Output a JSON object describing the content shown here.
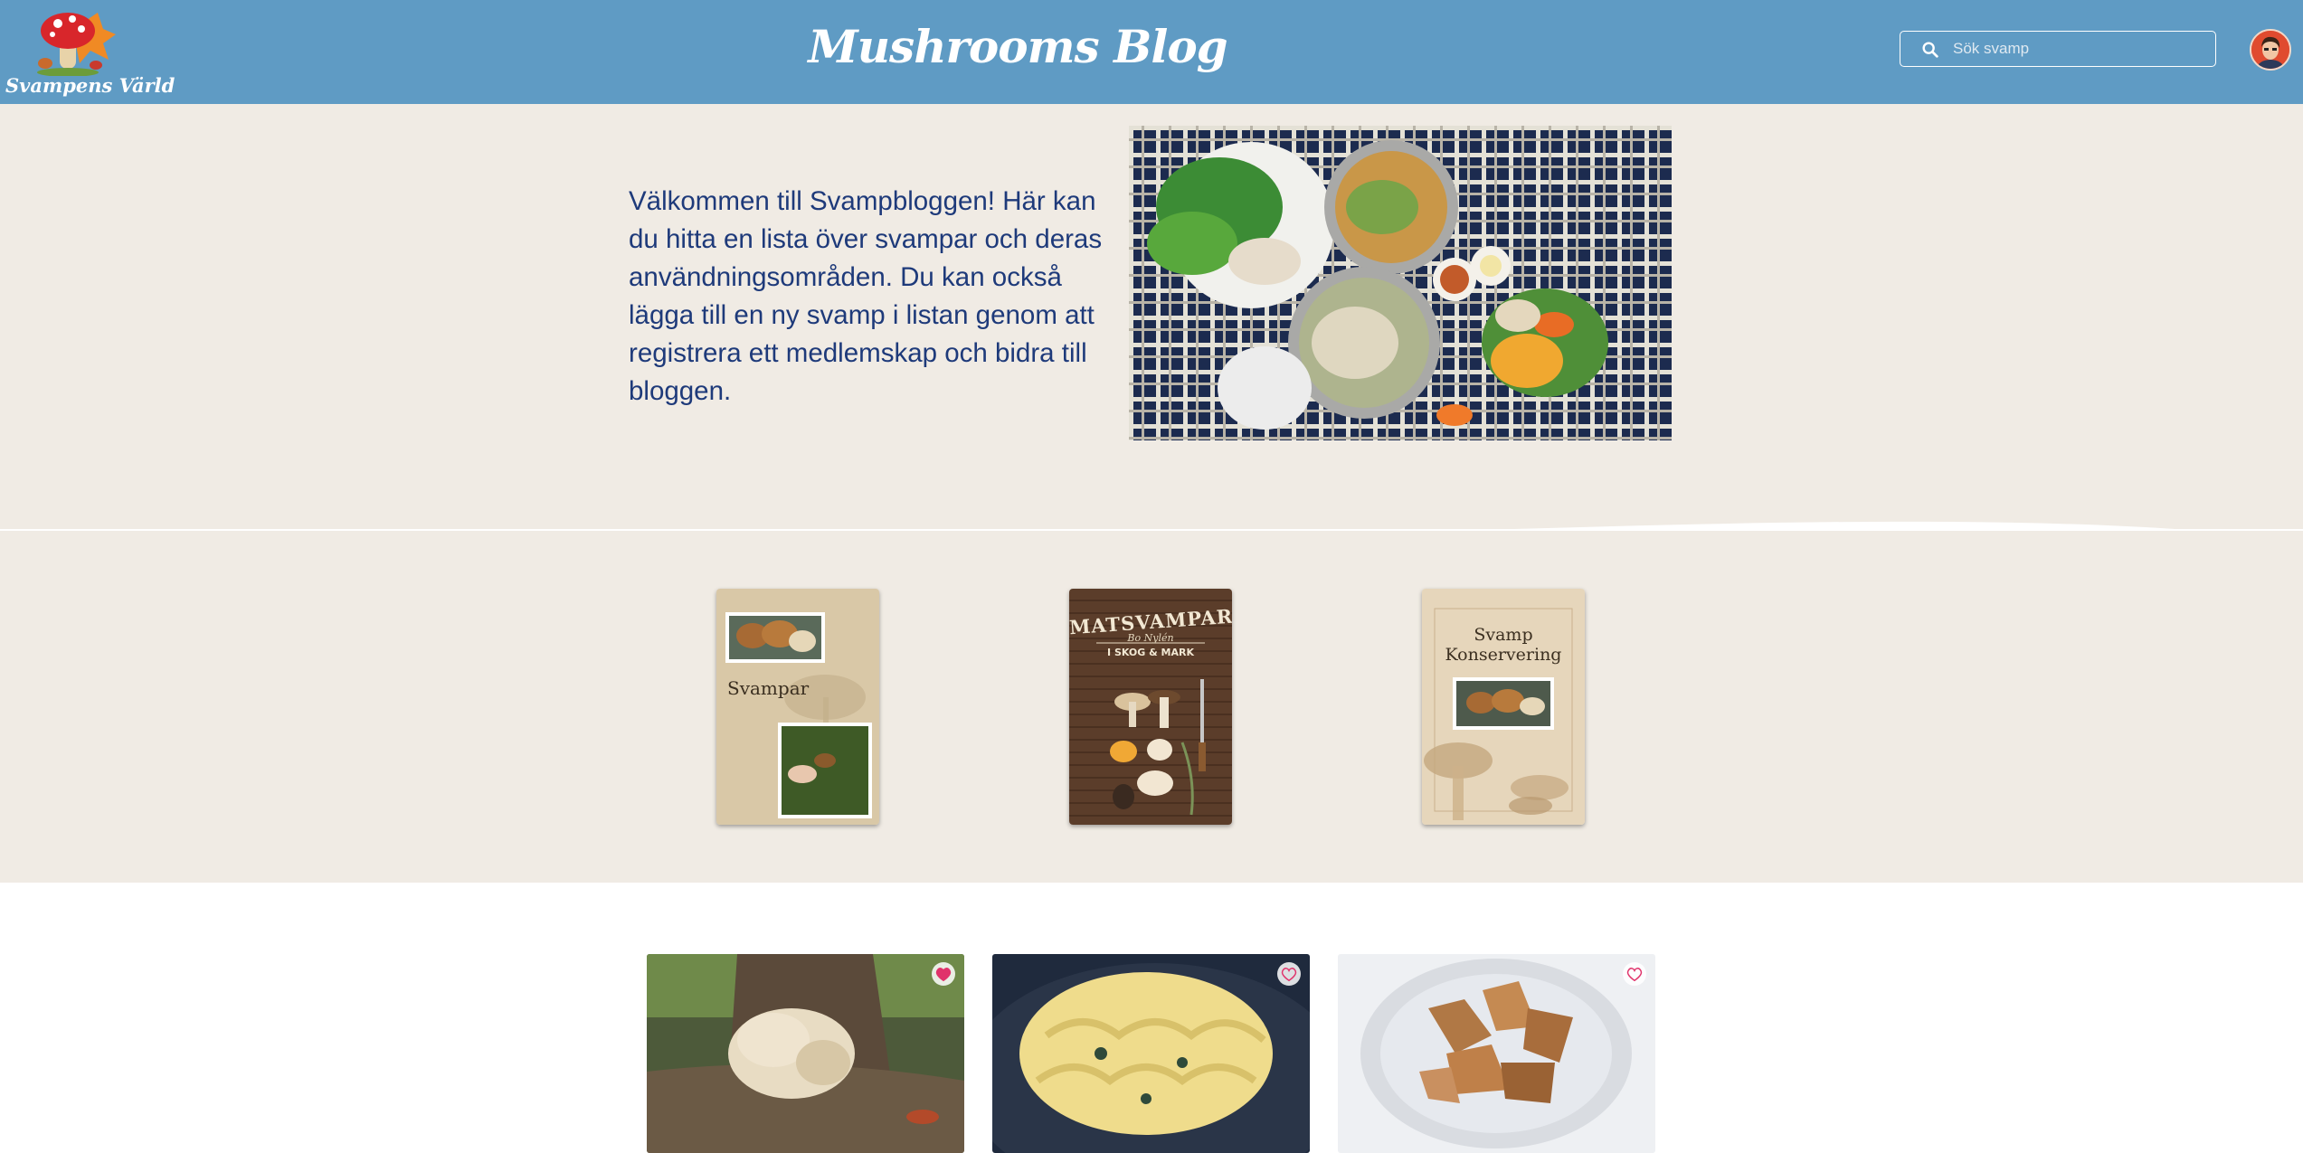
{
  "header": {
    "logo_text": "Svampens Värld",
    "title": "Mushrooms Blog",
    "search": {
      "placeholder": "Sök svamp",
      "value": ""
    }
  },
  "hero": {
    "text": "Välkommen till Svampbloggen! Här kan du hitta en lista över svampar och deras användningsområden. Du kan också lägga till en ny svamp i listan genom att registrera ett medlemskap och bidra till bloggen."
  },
  "books": [
    {
      "title": "Svampar"
    },
    {
      "title": "MATSVAMPAR",
      "author": "Bo Nylén",
      "subtitle": "I SKOG & MARK"
    },
    {
      "title_line1": "Svamp",
      "title_line2": "Konservering"
    }
  ],
  "cards": [
    {
      "favorited": true
    },
    {
      "favorited": false
    },
    {
      "favorited": false
    }
  ],
  "colors": {
    "header": "#5f9bc4",
    "background": "#f0ebe4",
    "hero_text": "#1e3a7a",
    "heart": "#e0336b"
  },
  "icons": [
    "search-icon",
    "heart-icon",
    "user-avatar",
    "mushroom-logo"
  ]
}
